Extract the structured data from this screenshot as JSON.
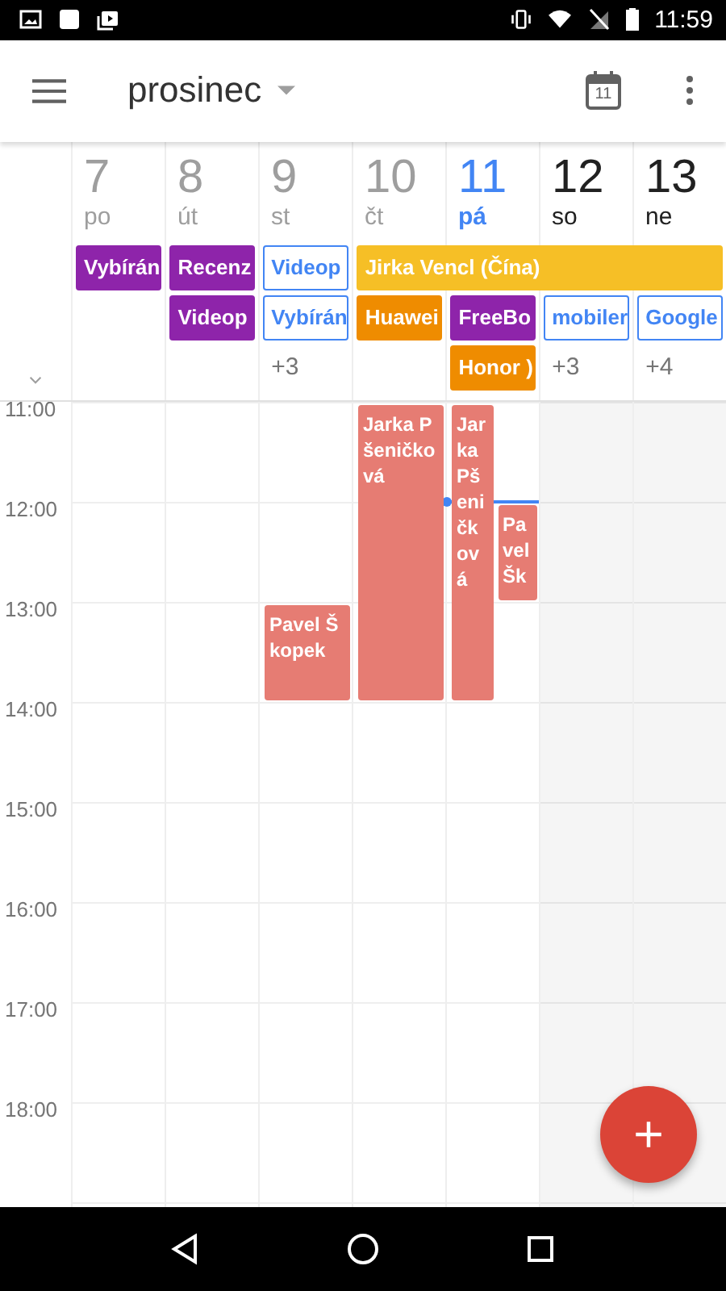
{
  "status_bar": {
    "time": "11:59"
  },
  "app_bar": {
    "title": "prosinec",
    "today_icon": "11"
  },
  "days": [
    {
      "number": "7",
      "name": "po",
      "today": false,
      "weekend": false,
      "all_day": [
        {
          "label": "Vybírán",
          "kind": "filled",
          "color": "#8e24aa"
        }
      ]
    },
    {
      "number": "8",
      "name": "út",
      "today": false,
      "weekend": false,
      "all_day": [
        {
          "label": "Recenz",
          "kind": "filled",
          "color": "#8e24aa"
        },
        {
          "label": "Videop",
          "kind": "filled",
          "color": "#8e24aa"
        }
      ]
    },
    {
      "number": "9",
      "name": "st",
      "today": false,
      "weekend": false,
      "all_day": [
        {
          "label": "Videop",
          "kind": "outline",
          "color": "#4285f4"
        },
        {
          "label": "Vybírán",
          "kind": "outline",
          "color": "#4285f4"
        }
      ],
      "more": "+3",
      "events": [
        {
          "title": "Pavel Škopek",
          "color": "#e67c73"
        }
      ]
    },
    {
      "number": "10",
      "name": "čt",
      "today": false,
      "weekend": false,
      "all_day": [
        {
          "label": "Jirka Vencl (Čína)",
          "kind": "span",
          "color": "#f6bf26"
        },
        {
          "label": "Huawei",
          "kind": "filled",
          "color": "#ef8c00"
        }
      ],
      "events": [
        {
          "title": "Jarka Pšeničková",
          "color": "#e67c73"
        }
      ]
    },
    {
      "number": "11",
      "name": "pá",
      "today": true,
      "weekend": false,
      "all_day": [
        {
          "label": "FreeBo",
          "kind": "filled",
          "color": "#8e24aa"
        },
        {
          "label": "Honor )",
          "kind": "filled",
          "color": "#ef8c00"
        }
      ],
      "events": [
        {
          "title": "Jarka Pšeničková",
          "color": "#e67c73"
        },
        {
          "title": "Pavel Šk",
          "color": "#e67c73"
        }
      ]
    },
    {
      "number": "12",
      "name": "so",
      "today": false,
      "weekend": true,
      "all_day": [
        {
          "label": "mobiler",
          "kind": "outline",
          "color": "#4285f4"
        }
      ],
      "more": "+3"
    },
    {
      "number": "13",
      "name": "ne",
      "today": false,
      "weekend": true,
      "all_day": [
        {
          "label": "Google",
          "kind": "outline",
          "color": "#4285f4"
        }
      ],
      "more": "+4"
    }
  ],
  "hours": [
    "11:00",
    "12:00",
    "13:00",
    "14:00",
    "15:00",
    "16:00",
    "17:00",
    "18:00"
  ]
}
